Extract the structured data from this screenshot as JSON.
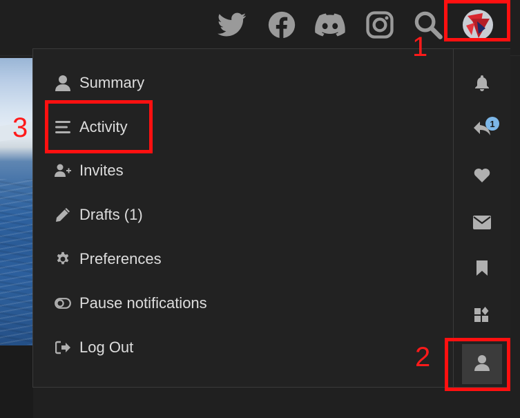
{
  "header": {
    "icons": [
      "twitter-icon",
      "facebook-icon",
      "discord-icon",
      "instagram-icon",
      "search-icon"
    ],
    "avatar": "user-avatar"
  },
  "user_menu": {
    "items": [
      {
        "label": "Summary",
        "icon": "user-icon"
      },
      {
        "label": "Activity",
        "icon": "list-icon"
      },
      {
        "label": "Invites",
        "icon": "user-plus-icon"
      },
      {
        "label": "Drafts (1)",
        "icon": "pencil-icon"
      },
      {
        "label": "Preferences",
        "icon": "gear-icon"
      },
      {
        "label": "Pause notifications",
        "icon": "toggle-icon"
      },
      {
        "label": "Log Out",
        "icon": "sign-out-icon"
      }
    ]
  },
  "rail": {
    "icons": [
      "bell-icon",
      "reply-icon",
      "heart-icon",
      "envelope-icon",
      "bookmark-icon",
      "apps-icon",
      "user-icon"
    ],
    "reply_badge": "1"
  },
  "annotations": {
    "n1": "1",
    "n2": "2",
    "n3": "3"
  },
  "colors": {
    "background": "#222222",
    "text": "#dddddd",
    "annotation": "#ff1010",
    "badge": "#7db7e8"
  }
}
